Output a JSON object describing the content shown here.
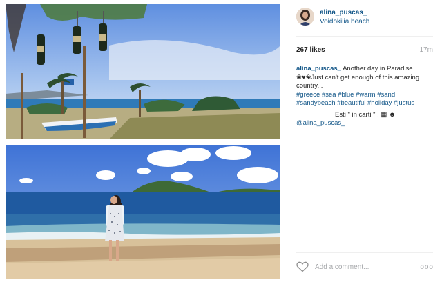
{
  "post": {
    "username": "alina_puscas_",
    "location": "Voidokilia beach",
    "likes": "267 likes",
    "time_ago": "17m",
    "caption_user": "alina_puscas_",
    "caption_line1": "Another day in Paradise",
    "caption_line2": "❀♥❀Just can't get enough of this amazing country...",
    "hashtags": "#greece #sea #blue #warm #sand #sandybeach #beautiful #holiday #justus",
    "caption_line3": "Esti \" in carti \" ! ▦ ☻",
    "mention": "@alina_puscas_",
    "comment_placeholder": "Add a comment...",
    "more_label": "ooo"
  },
  "icons": {
    "like": "heart-outline-icon",
    "options": "more-options-icon"
  },
  "colors": {
    "link": "#125688",
    "muted": "#a5a7aa",
    "divider": "#efefef"
  }
}
